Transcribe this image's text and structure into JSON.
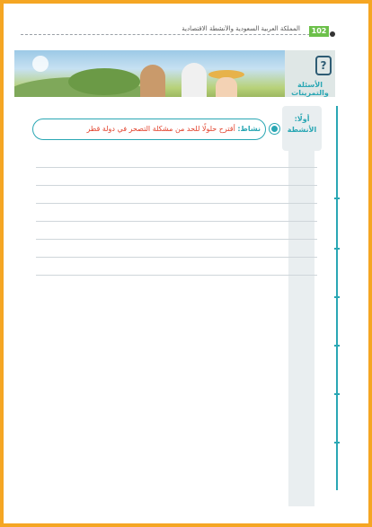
{
  "header": {
    "page_number": "102",
    "book_title": "المملكة العربية السعودية والأنشطة الاقتصادية"
  },
  "section": {
    "icon": "question-book-icon",
    "label": "الأسئلة والتمرينات"
  },
  "activity": {
    "label_line1": "أولًا:",
    "label_line2": "الأنشطة",
    "keyword": "نشاط:",
    "text": "أقترح حلولًا للحد من مشكلة التصحر في دولة قطر"
  },
  "answer_lines_count": 7,
  "colors": {
    "frame": "#f5a623",
    "accent": "#2aa7b4",
    "activity_text": "#e2412b",
    "page_number_bg": "#6cc04a"
  }
}
